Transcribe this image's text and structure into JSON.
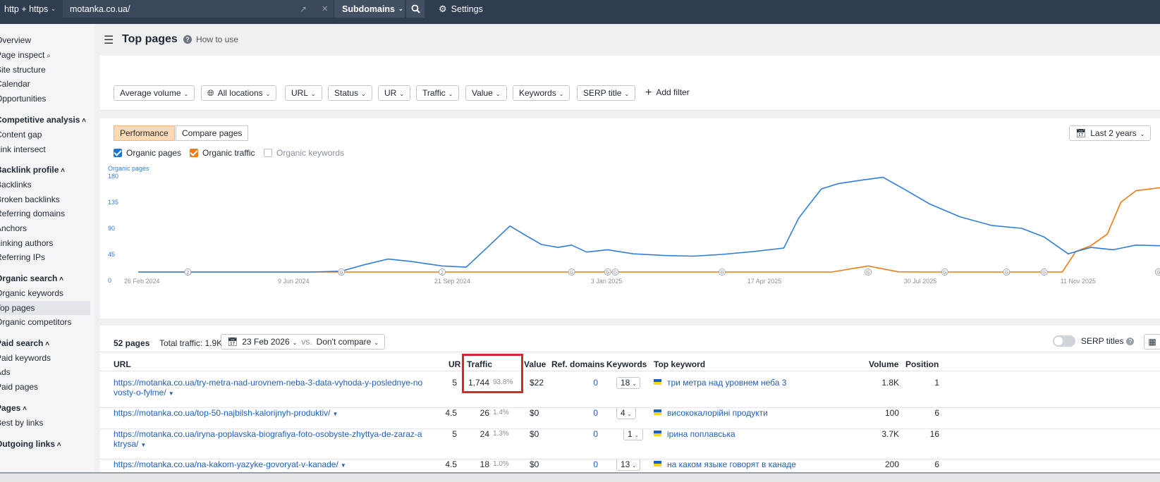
{
  "topbar": {
    "protocol": "http + https",
    "url": "motanka.co.ua/",
    "mode": "Subdomains",
    "settings": "Settings"
  },
  "sidebar": {
    "items": [
      {
        "label": "Overview"
      },
      {
        "label": "Page inspect"
      },
      {
        "label": "Site structure"
      },
      {
        "label": "Calendar"
      },
      {
        "label": "Opportunities"
      },
      {
        "label": "Competitive analysis",
        "heading": true
      },
      {
        "label": "Content gap"
      },
      {
        "label": "Link intersect"
      },
      {
        "label": "Backlink profile",
        "heading": true
      },
      {
        "label": "Backlinks"
      },
      {
        "label": "Broken backlinks"
      },
      {
        "label": "Referring domains"
      },
      {
        "label": "Anchors"
      },
      {
        "label": "Linking authors"
      },
      {
        "label": "Referring IPs"
      },
      {
        "label": "Organic search",
        "heading": true
      },
      {
        "label": "Organic keywords"
      },
      {
        "label": "Top pages",
        "active": true
      },
      {
        "label": "Organic competitors"
      },
      {
        "label": "Paid search",
        "heading": true
      },
      {
        "label": "Paid keywords"
      },
      {
        "label": "Ads"
      },
      {
        "label": "Paid pages"
      },
      {
        "label": "Pages",
        "heading": true
      },
      {
        "label": "Best by links"
      },
      {
        "label": "Outgoing links",
        "heading": true
      }
    ]
  },
  "header": {
    "title": "Top pages",
    "how_to_use": "How to use"
  },
  "filters": {
    "average_volume": "Average volume",
    "all_locations": "All locations",
    "url": "URL",
    "status": "Status",
    "ur": "UR",
    "traffic": "Traffic",
    "value": "Value",
    "keywords": "Keywords",
    "serp_title": "SERP title",
    "add_filter": "Add filter"
  },
  "chart_controls": {
    "performance": "Performance",
    "compare_pages": "Compare pages",
    "last_2_years": "Last 2 years",
    "organic_pages": "Organic pages",
    "organic_traffic": "Organic traffic",
    "organic_keywords": "Organic keywords"
  },
  "colors": {
    "organic_pages": "#2f7ed8",
    "organic_traffic": "#f07c10",
    "highlight": "#d7262f"
  },
  "chart_data": {
    "type": "line",
    "ylabel": "Organic pages",
    "yticks": [
      "0",
      "45",
      "90",
      "135",
      "180"
    ],
    "ylim": [
      0,
      180
    ],
    "xticks": [
      "26 Feb 2024",
      "9 Jun 2024",
      "21 Sep 2024",
      "3 Jan 2025",
      "17 Apr 2025",
      "30 Jul 2025",
      "11 Nov 2025"
    ],
    "annotations": [
      "2",
      "G",
      "2",
      "G",
      "G",
      "G",
      "G",
      "G",
      "G",
      "G",
      "G",
      "G"
    ],
    "series": [
      {
        "name": "Organic pages",
        "x": [
          "2024-02-26",
          "2024-03-30",
          "2024-05-04",
          "2024-06-01",
          "2024-06-20",
          "2024-07-10",
          "2024-07-25",
          "2024-08-10",
          "2024-08-25",
          "2024-09-15",
          "2024-10-01",
          "2024-10-15",
          "2024-10-30",
          "2024-11-08",
          "2024-11-20",
          "2024-12-01",
          "2024-12-10",
          "2024-12-20",
          "2025-01-03",
          "2025-01-20",
          "2025-02-10",
          "2025-03-01",
          "2025-03-20",
          "2025-04-10",
          "2025-04-30",
          "2025-05-10",
          "2025-05-25",
          "2025-06-05",
          "2025-06-20",
          "2025-07-05",
          "2025-07-20",
          "2025-08-05",
          "2025-08-25",
          "2025-09-15",
          "2025-10-05",
          "2025-10-20",
          "2025-11-05",
          "2025-11-20",
          "2025-12-05",
          "2025-12-20",
          "2026-01-05"
        ],
        "values": [
          0,
          1,
          2,
          3,
          9,
          16,
          27,
          37,
          33,
          25,
          23,
          57,
          94,
          80,
          62,
          57,
          61,
          49,
          53,
          46,
          43,
          42,
          45,
          50,
          56,
          108,
          158,
          167,
          173,
          178,
          156,
          132,
          110,
          95,
          90,
          75,
          46,
          57,
          53,
          61,
          60
        ]
      },
      {
        "name": "Organic traffic",
        "x": [
          "2024-02-26",
          "2024-06-01",
          "2024-07-10",
          "2024-08-10",
          "2024-09-01",
          "2024-09-15",
          "2024-10-15",
          "2024-12-01",
          "2025-02-01",
          "2025-04-01",
          "2025-05-01",
          "2025-06-01",
          "2025-06-25",
          "2025-07-15",
          "2025-08-01",
          "2025-09-01",
          "2025-10-01",
          "2025-10-15",
          "2025-11-01",
          "2025-11-10",
          "2025-11-20",
          "2025-12-01",
          "2025-12-10",
          "2025-12-20",
          "2026-01-05"
        ],
        "values": [
          0,
          1,
          8,
          13,
          14,
          6,
          1,
          3,
          2,
          1,
          6,
          8,
          25,
          15,
          9,
          8,
          8,
          12,
          12,
          50,
          60,
          80,
          135,
          155,
          160
        ]
      }
    ]
  },
  "table_header": {
    "pages_count": "52 pages",
    "total_traffic": "Total traffic: 1.9K",
    "date": "23 Feb 2026",
    "vs": "vs.",
    "compare": "Don't compare",
    "serp_titles": "SERP titles"
  },
  "table": {
    "columns": [
      "URL",
      "UR",
      "Traffic",
      "Value",
      "Ref. domains",
      "Keywords",
      "Top keyword",
      "Volume",
      "Position"
    ],
    "rows": [
      {
        "url": "https://motanka.co.ua/try-metra-nad-urovnem-neba-3-data-vyhoda-y-poslednye-novosty-o-fylme/",
        "ur": "5",
        "traffic": "1,744",
        "share": "93.8%",
        "value": "$22",
        "ref_domains": "0",
        "keywords": "18",
        "top_keyword": "три метра над уровнем неба 3",
        "volume": "1.8K",
        "position": "1"
      },
      {
        "url": "https://motanka.co.ua/top-50-najbilsh-kalorijnyh-produktiv/",
        "ur": "4.5",
        "traffic": "26",
        "share": "1.4%",
        "value": "$0",
        "ref_domains": "0",
        "keywords": "4",
        "top_keyword": "висококалорійні продукти",
        "volume": "100",
        "position": "6"
      },
      {
        "url": "https://motanka.co.ua/iryna-poplavska-biografiya-foto-osobyste-zhyttya-de-zaraz-aktrysa/",
        "ur": "5",
        "traffic": "24",
        "share": "1.3%",
        "value": "$0",
        "ref_domains": "0",
        "keywords": "1",
        "top_keyword": "ірина поплавська",
        "volume": "3.7K",
        "position": "16"
      },
      {
        "url": "https://motanka.co.ua/na-kakom-yazyke-govoryat-v-kanade/",
        "ur": "4.5",
        "traffic": "18",
        "share": "1.0%",
        "value": "$0",
        "ref_domains": "0",
        "keywords": "13",
        "top_keyword": "на каком языке говорят в канаде",
        "volume": "200",
        "position": "6"
      }
    ]
  }
}
